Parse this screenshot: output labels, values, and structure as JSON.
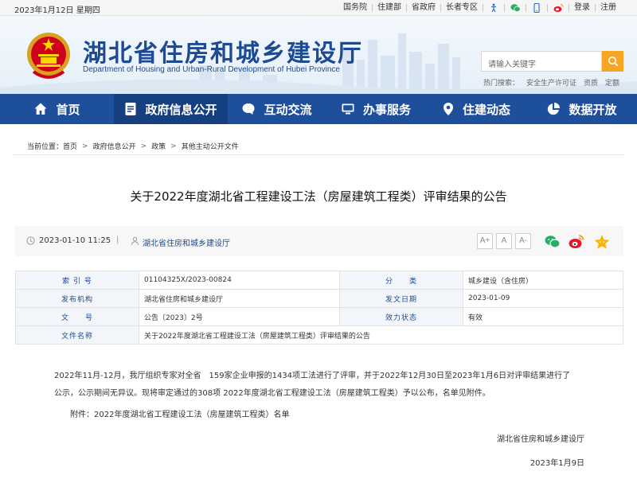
{
  "topbar": {
    "date": "2023年1月12日 星期四",
    "links": [
      "国务院",
      "住建部",
      "省政府",
      "长者专区",
      "登录",
      "注册"
    ]
  },
  "header": {
    "title": "湖北省住房和城乡建设厅",
    "subtitle": "Department of Housing and Urban-Rural Development of Hubei Province",
    "search_placeholder": "请输入关键字",
    "hot_label": "热门搜索：",
    "hot_items": [
      "安全生产许可证",
      "资质",
      "定额"
    ]
  },
  "nav": {
    "items": [
      {
        "label": "首页",
        "icon": "home-icon"
      },
      {
        "label": "政府信息公开",
        "icon": "document-icon"
      },
      {
        "label": "互动交流",
        "icon": "chat-icon"
      },
      {
        "label": "办事服务",
        "icon": "monitor-icon"
      },
      {
        "label": "住建动态",
        "icon": "location-icon"
      },
      {
        "label": "数据开放",
        "icon": "pie-chart-icon"
      }
    ],
    "active_index": 1
  },
  "breadcrumb": {
    "label": "当前位置：",
    "items": [
      "首页",
      "政府信息公开",
      "政策",
      "其他主动公开文件"
    ]
  },
  "article": {
    "title": "关于2022年度湖北省工程建设工法（房屋建筑工程类）评审结果的公告",
    "time": "2023-01-10 11:25",
    "separator": "|",
    "publisher": "湖北省住房和城乡建设厅",
    "font_sizes": [
      "A+",
      "A",
      "A-"
    ]
  },
  "info_table": {
    "index_label": "索 引 号",
    "index_value": "01104325X/2023-00824",
    "category_label": "分　　类",
    "category_value": "城乡建设（含住房）",
    "issuer_label": "发布机构",
    "issuer_value": "湖北省住房和城乡建设厅",
    "date_label": "发文日期",
    "date_value": "2023-01-09",
    "docno_label": "文　　号",
    "docno_value": "公告〔2023〕2号",
    "status_label": "效力状态",
    "status_value": "有效",
    "name_label": "文件名称",
    "name_value": "关于2022年度湖北省工程建设工法（房屋建筑工程类）评审结果的公告"
  },
  "content": {
    "para1_line1": "2022年11月-12月，我厅组织专家对全省　159家企业申报的1434项工法进行了评审，并于2022年12月30日至2023年1月6日对评审结果进行了",
    "para1_line2": "公示，公示期间无异议。现将审定通过的308项 2022年度湖北省工程建设工法（房屋建筑工程类）予以公布，名单见附件。",
    "attachment": "附件：2022年度湖北省工程建设工法（房屋建筑工程类）名单",
    "signature": "湖北省住房和城乡建设厅",
    "sign_date": "2023年1月9日"
  },
  "colors": {
    "nav_bg": "#1e4f9a",
    "nav_active": "#163f7f",
    "title_blue": "#1c4a93",
    "search_orange": "#f6a623"
  }
}
